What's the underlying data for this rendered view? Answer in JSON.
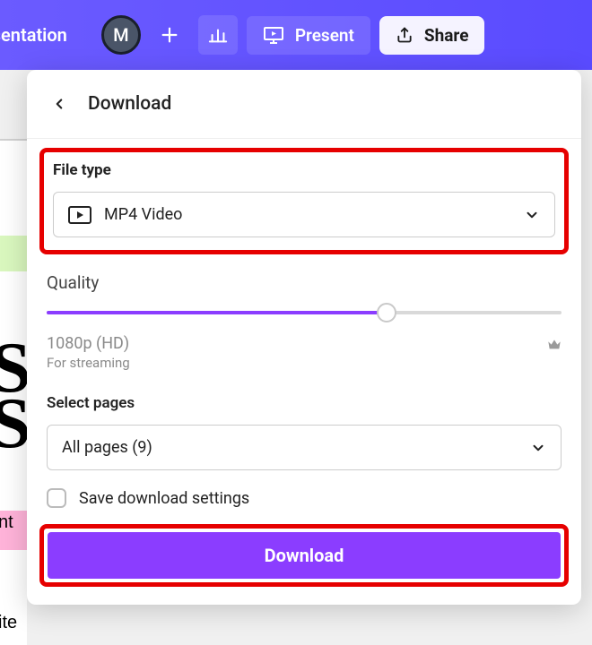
{
  "colors": {
    "accent": "#8b3dff",
    "highlight": "#e60000",
    "topbar": "#5a4bff"
  },
  "topbar": {
    "title_fragment": "esentation",
    "avatar_initial": "M",
    "present_label": "Present",
    "share_label": "Share"
  },
  "panel": {
    "title": "Download"
  },
  "file_type": {
    "label": "File type",
    "selected": "MP4 Video"
  },
  "quality": {
    "label": "Quality",
    "value_label": "1080p (HD)",
    "sub_label": "For streaming",
    "slider_percent": 66
  },
  "select_pages": {
    "label": "Select pages",
    "selected": "All pages (9)"
  },
  "save_settings": {
    "label": "Save download settings",
    "checked": false
  },
  "download_button": {
    "label": "Download"
  },
  "bg_fragments": {
    "a": "nt",
    "b": "ite"
  }
}
